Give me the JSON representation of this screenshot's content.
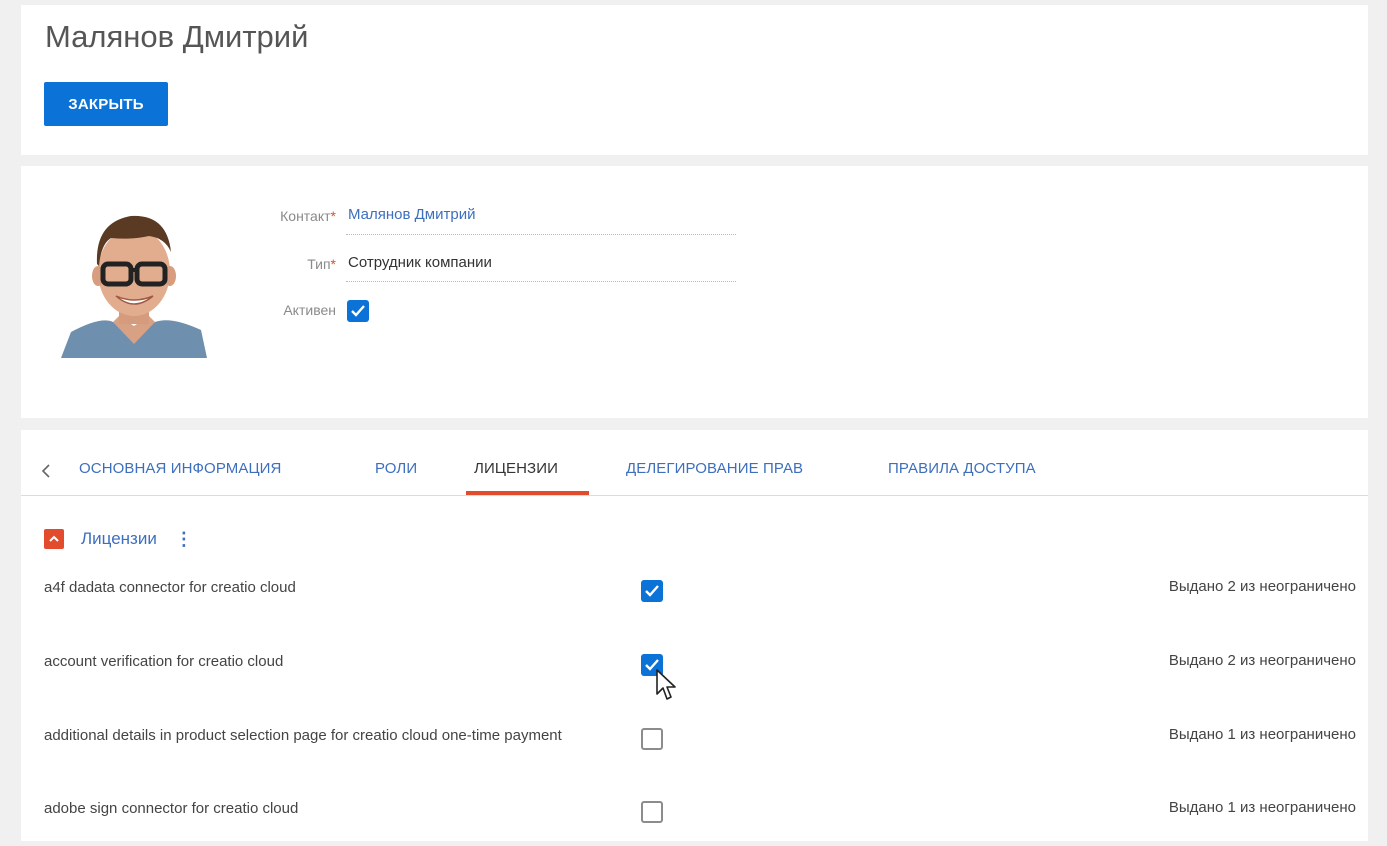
{
  "page": {
    "title": "Малянов Дмитрий",
    "close_button": "ЗАКРЫТЬ"
  },
  "profile": {
    "contact_label": "Контакт",
    "contact_value": "Малянов Дмитрий",
    "type_label": "Тип",
    "type_value": "Сотрудник компании",
    "active_label": "Активен",
    "active_checked": true,
    "required_mark": "*"
  },
  "tabs": [
    {
      "label": "ОСНОВНАЯ ИНФОРМАЦИЯ",
      "active": false
    },
    {
      "label": "РОЛИ",
      "active": false
    },
    {
      "label": "ЛИЦЕНЗИИ",
      "active": true
    },
    {
      "label": "ДЕЛЕГИРОВАНИЕ ПРАВ",
      "active": false
    },
    {
      "label": "ПРАВИЛА ДОСТУПА",
      "active": false
    }
  ],
  "licenses": {
    "group_title": "Лицензии",
    "menu_icon": "⋮",
    "rows": [
      {
        "name": "a4f dadata connector for creatio cloud",
        "checked": true,
        "status": "Выдано 2 из неограничено"
      },
      {
        "name": "account verification for creatio cloud",
        "checked": true,
        "status": "Выдано 2 из неограничено"
      },
      {
        "name": "additional details in product selection page for creatio cloud one-time payment",
        "checked": false,
        "status": "Выдано 1 из неограничено"
      },
      {
        "name": "adobe sign connector for creatio cloud",
        "checked": false,
        "status": "Выдано 1 из неограничено"
      }
    ]
  },
  "colors": {
    "accent_blue": "#0b72d8",
    "link_blue": "#3d6fbd",
    "accent_red": "#e34b2d"
  }
}
